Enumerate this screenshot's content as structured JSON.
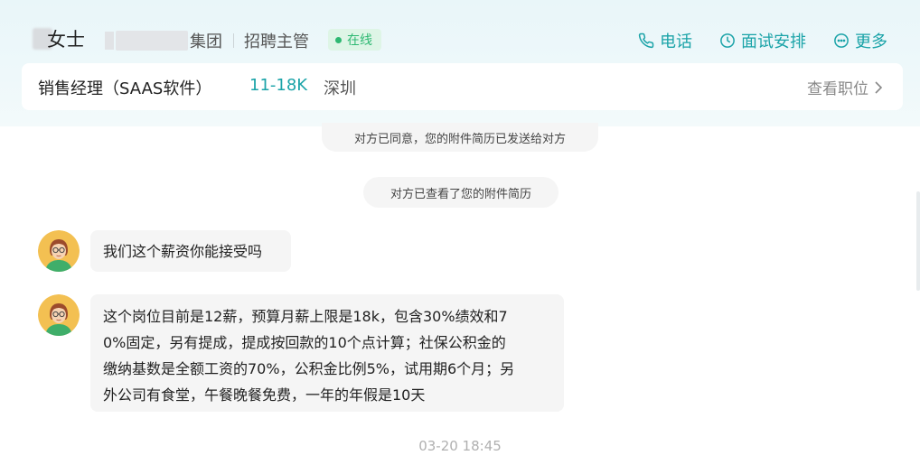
{
  "header": {
    "contact_name": "女士",
    "company_suffix": "集团",
    "role": "招聘主管",
    "status": "在线",
    "actions": [
      {
        "label": "电话",
        "icon": "phone-icon"
      },
      {
        "label": "面试安排",
        "icon": "clock-icon"
      },
      {
        "label": "更多",
        "icon": "more-icon"
      }
    ]
  },
  "job": {
    "title": "销售经理（SAAS软件）",
    "salary": "11-18K",
    "city": "深圳",
    "view_link": "查看职位"
  },
  "chat": {
    "system_messages": [
      "对方已同意，您的附件简历已发送给对方",
      "对方已查看了您的附件简历"
    ],
    "messages": [
      {
        "text_lines": [
          "我们这个薪资你能接受吗"
        ]
      },
      {
        "text_lines": [
          "这个岗位目前是12薪，预算月薪上限是18k，包含30%绩效和7",
          "0%固定，另有提成，提成按回款的10个点计算；社保公积金的",
          "缴纳基数是全额工资的70%，公积金比例5%，试用期6个月；另",
          "外公司有食堂，午餐晚餐免费，一年的年假是10天"
        ]
      }
    ],
    "timestamp": "03-20 18:45"
  },
  "colors": {
    "accent": "#1aa3a8",
    "online": "#2eb872",
    "bubble": "#f5f5f5",
    "header_bg": "#eaf6f9"
  }
}
